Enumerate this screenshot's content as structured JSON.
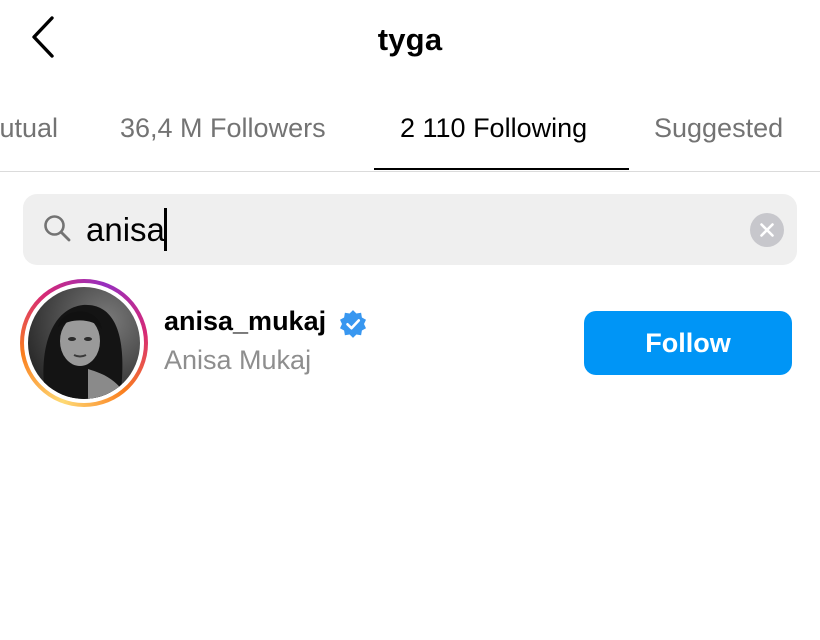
{
  "header": {
    "title": "tyga",
    "back_icon": "chevron-left-icon"
  },
  "tabs": [
    {
      "label": "Mutual",
      "active": false
    },
    {
      "label": "36,4 M Followers",
      "active": false
    },
    {
      "label": "2 110 Following",
      "active": true
    },
    {
      "label": "Suggested",
      "active": false
    }
  ],
  "search": {
    "value": "anisa",
    "icon": "search-icon",
    "clear_icon": "clear-icon"
  },
  "results": [
    {
      "username": "anisa_mukaj",
      "full_name": "Anisa Mukaj",
      "verified": true,
      "follow_label": "Follow"
    }
  ],
  "colors": {
    "accent": "#0095f6",
    "verified_badge": "#3897f0",
    "secondary_text": "#737373",
    "search_bg": "#efefef"
  }
}
